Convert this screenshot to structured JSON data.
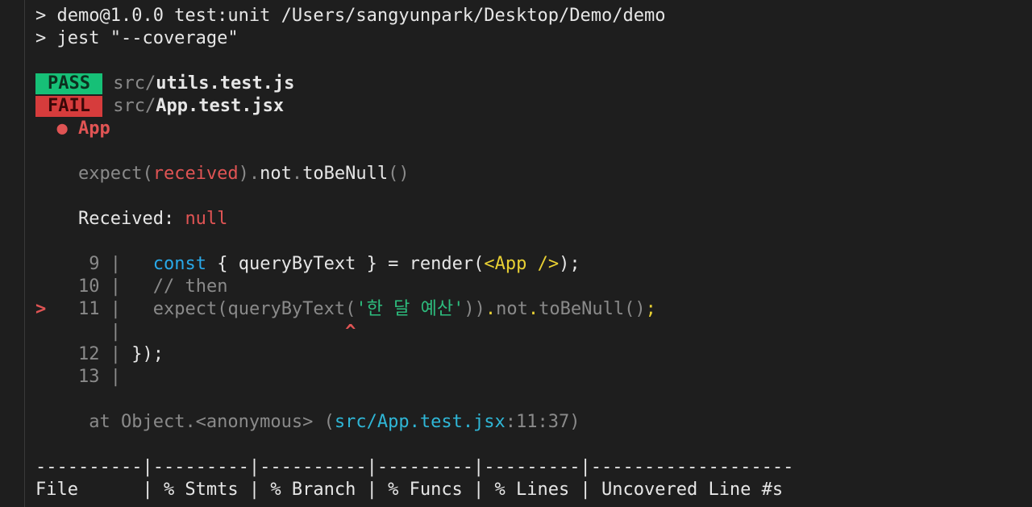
{
  "cmd": {
    "line1": "> demo@1.0.0 test:unit /Users/sangyunpark/Desktop/Demo/demo",
    "line2": "> jest \"--coverage\""
  },
  "results": [
    {
      "status": "PASS",
      "dir": "src/",
      "file": "utils.test.js"
    },
    {
      "status": "FAIL",
      "dir": "src/",
      "file": "App.test.jsx"
    }
  ],
  "failure": {
    "bullet": "●",
    "title": "App",
    "expect": {
      "fn": "expect(",
      "received": "received",
      "close": ")",
      "dot1": ".",
      "not": "not",
      "dot2": ".",
      "matcher": "toBeNull",
      "parens": "()"
    },
    "received_label": "Received: ",
    "received_value": "null"
  },
  "code": {
    "l9_num": "9",
    "l9_const": "const",
    "l9_mid": " { queryByText } = ",
    "l9_render": "render(",
    "l9_jsx": "<App />",
    "l9_end": ");",
    "l10_num": "10",
    "l10_comment": "// then",
    "l11_marker": ">",
    "l11_num": "11",
    "l11_pre": "expect(queryByText(",
    "l11_str": "'한 달 예산'",
    "l11_mid": "))",
    "l11_dot": ".",
    "l11_not": "not",
    "l11_dot2": ".",
    "l11_tail": "toBeNull()",
    "l11_semi": ";",
    "caret": "^",
    "l12_num": "12",
    "l12_code": "});",
    "l13_num": "13",
    "bar": "|"
  },
  "stack": {
    "at": "at Object.<anonymous> (",
    "path": "src/App.test.jsx",
    "pos": ":11:37)"
  },
  "coverage": {
    "divider": "----------|---------|----------|---------|---------|-------------------",
    "header": "File      | % Stmts | % Branch | % Funcs | % Lines | Uncovered Line #s"
  }
}
